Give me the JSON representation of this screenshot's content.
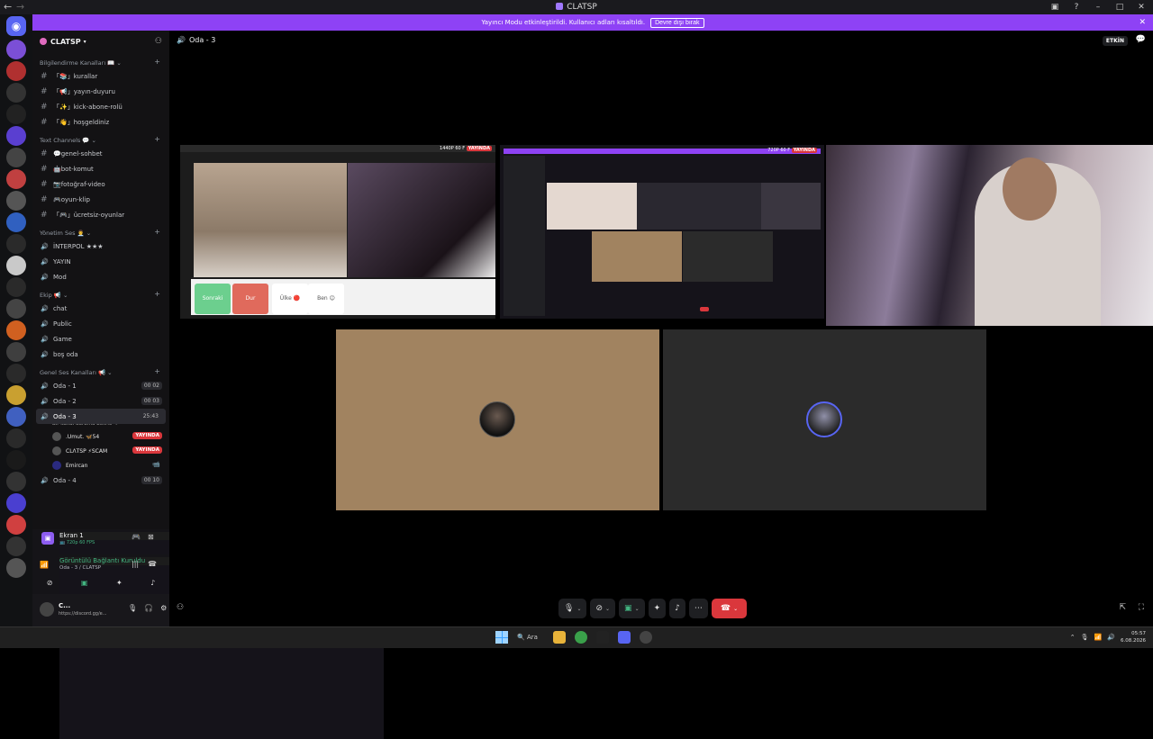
{
  "titlebar": {
    "back": "←",
    "forward": "→",
    "title": "CLATSP"
  },
  "banner": {
    "text": "Yayıncı Modu etkinleştirildi. Kullanıcı adları kısaltıldı.",
    "button": "Devre dışı bırak",
    "close": "✕"
  },
  "rail": {
    "home_icon": "discord-icon",
    "servers": [
      "#7b4fd6",
      "#b03030",
      "#333",
      "#222",
      "#5a3fd0",
      "#444",
      "#c04040",
      "#555",
      "#3060c0",
      "#2a2a2a",
      "#c9c9c9",
      "#2a2a2a",
      "#444",
      "#d06020",
      "#3f3f3f",
      "#2a2a2a",
      "#c9a030",
      "#4060c0",
      "#2a2a2a",
      "#1a1a1a",
      "#333",
      "#4a3fd0",
      "#d04040",
      "#333",
      "#555"
    ]
  },
  "guild": {
    "name": "CLATSP"
  },
  "categories": [
    {
      "label": "Bilgilendirme Kanalları 📖",
      "channels": [
        {
          "icon": "#",
          "name": "「📚」kurallar"
        },
        {
          "icon": "#",
          "name": "「📢」yayın-duyuru"
        },
        {
          "icon": "#",
          "name": "「✨」kick-abone-rolü"
        },
        {
          "icon": "#",
          "name": "「👋」hoşgeldiniz"
        }
      ]
    },
    {
      "label": "Text Channels 💬",
      "channels": [
        {
          "icon": "#",
          "name": "💬genel-sohbet"
        },
        {
          "icon": "#",
          "name": "🤖bot-komut"
        },
        {
          "icon": "#",
          "name": "📷fotoğraf-video"
        },
        {
          "icon": "#",
          "name": "🎮oyun-klip"
        },
        {
          "icon": "#",
          "name": "「🎮」ücretsiz-oyunlar"
        }
      ]
    },
    {
      "label": "Yönetim Ses 👨‍💼",
      "channels": [
        {
          "icon": "🔊",
          "name": "İNTERPOL ★★★"
        },
        {
          "icon": "🔊",
          "name": "YAYIN"
        },
        {
          "icon": "🔊",
          "name": "Mod"
        }
      ]
    },
    {
      "label": "Ekip 📢",
      "channels": [
        {
          "icon": "🔊",
          "name": "chat"
        },
        {
          "icon": "🔊",
          "name": "Public"
        },
        {
          "icon": "🔊",
          "name": "Game"
        },
        {
          "icon": "🔊",
          "name": "boş oda"
        }
      ]
    }
  ],
  "voice_category": {
    "label": "Genel Ses Kanalları 📢",
    "channels": [
      {
        "name": "Oda - 1",
        "badge": "00 02"
      },
      {
        "name": "Oda - 2",
        "badge": "00 03"
      },
      {
        "name": "Oda - 3",
        "timer": "25:43",
        "status": "Bir kanal durumu belirle ✎"
      },
      {
        "name": "Oda - 4",
        "badge": "00 10"
      }
    ],
    "members": [
      {
        "name": ".Umut. 🦋54",
        "live": "YAYINDA"
      },
      {
        "name": "CLΛTSP ⚡SCAM",
        "live": "YAYINDA"
      },
      {
        "name": "Emircan",
        "cam": "📹"
      }
    ]
  },
  "stream_panel": {
    "title": "Ekran 1",
    "sub": "📺 720p 60 FPS"
  },
  "voice_panel": {
    "status": "Görüntülü Bağlantı Kuruldu",
    "channel": "Oda - 3 / CLATSP"
  },
  "user": {
    "name": "C...",
    "status": "https://discord.gg/e..."
  },
  "header": {
    "channel": "Oda - 3",
    "etkin": "ETKİN"
  },
  "tiles": {
    "t1": {
      "quality": "1440P 60 F",
      "live": "YAYINDA",
      "skip": "Sonraki",
      "stop": "Dur",
      "ulke": "Ülke 🔴",
      "ben": "Ben 😊"
    },
    "t2": {
      "quality": "720P 60 F",
      "live": "YAYINDA"
    }
  },
  "taskbar": {
    "search": "Ara",
    "time": "05:57",
    "date": "6.08.2026"
  }
}
